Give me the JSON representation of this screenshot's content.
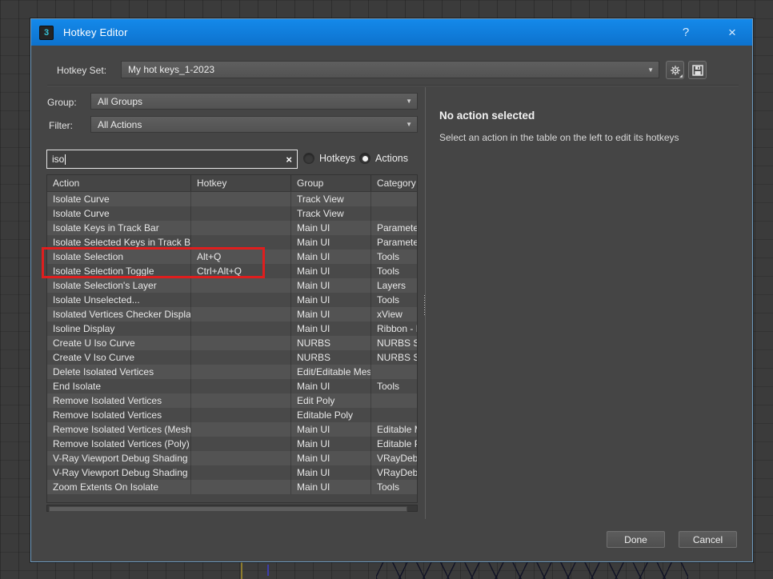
{
  "window": {
    "title": "Hotkey Editor",
    "help_label": "?",
    "close_label": "×",
    "app_icon_text": "3"
  },
  "hotkey_set": {
    "label": "Hotkey Set:",
    "value": "My hot keys_1-2023"
  },
  "group": {
    "label": "Group:",
    "value": "All Groups"
  },
  "filter": {
    "label": "Filter:",
    "value": "All Actions"
  },
  "search": {
    "value": "iso",
    "clear_label": "×"
  },
  "radios": {
    "hotkeys_label": "Hotkeys",
    "actions_label": "Actions",
    "selected": "Actions"
  },
  "table": {
    "headers": [
      "Action",
      "Hotkey",
      "Group",
      "Category"
    ],
    "rows": [
      [
        "Isolate Curve",
        "",
        "Track View",
        ""
      ],
      [
        "Isolate Curve",
        "",
        "Track View",
        ""
      ],
      [
        "Isolate Keys in Track Bar",
        "",
        "Main UI",
        "Parameter ."
      ],
      [
        "Isolate Selected Keys in Track Bar",
        "",
        "Main UI",
        "Parameter ."
      ],
      [
        "Isolate Selection",
        "Alt+Q",
        "Main UI",
        "Tools"
      ],
      [
        "Isolate Selection Toggle",
        "Ctrl+Alt+Q",
        "Main UI",
        "Tools"
      ],
      [
        "Isolate Selection's Layer",
        "",
        "Main UI",
        "Layers"
      ],
      [
        "Isolate Unselected...",
        "",
        "Main UI",
        "Tools"
      ],
      [
        "Isolated Vertices Checker Display...",
        "",
        "Main UI",
        "xView"
      ],
      [
        "Isoline Display",
        "",
        "Main UI",
        "Ribbon - M."
      ],
      [
        "Create U Iso Curve",
        "",
        "NURBS",
        "NURBS Sur."
      ],
      [
        "Create V Iso Curve",
        "",
        "NURBS",
        "NURBS Sur."
      ],
      [
        "Delete Isolated Vertices",
        "",
        "Edit/Editable Mesh",
        ""
      ],
      [
        "End Isolate",
        "",
        "Main UI",
        "Tools"
      ],
      [
        "Remove Isolated Vertices",
        "",
        "Edit Poly",
        ""
      ],
      [
        "Remove Isolated Vertices",
        "",
        "Editable Poly",
        ""
      ],
      [
        "Remove Isolated Vertices (Mesh)",
        "",
        "Main UI",
        "Editable M.."
      ],
      [
        "Remove Isolated Vertices (Poly)",
        "",
        "Main UI",
        "Editable Po."
      ],
      [
        "V-Ray Viewport Debug Shading I...",
        "",
        "Main UI",
        "VRayDebu.."
      ],
      [
        "V-Ray Viewport Debug Shading I...",
        "",
        "Main UI",
        "VRayDebu.."
      ],
      [
        "Zoom Extents On Isolate",
        "",
        "Main UI",
        "Tools"
      ]
    ]
  },
  "detail": {
    "title": "No action selected",
    "subtitle": "Select an action in the table on the left to edit its hotkeys"
  },
  "footer": {
    "done_label": "Done",
    "cancel_label": "Cancel"
  },
  "colors": {
    "titlebar_blue": "#1182e0",
    "dialog_bg": "#454545",
    "dialog_border": "#6f9bc0",
    "annotation_red": "#df1e1e",
    "row_light": "#535353",
    "row_dark": "#494949"
  }
}
